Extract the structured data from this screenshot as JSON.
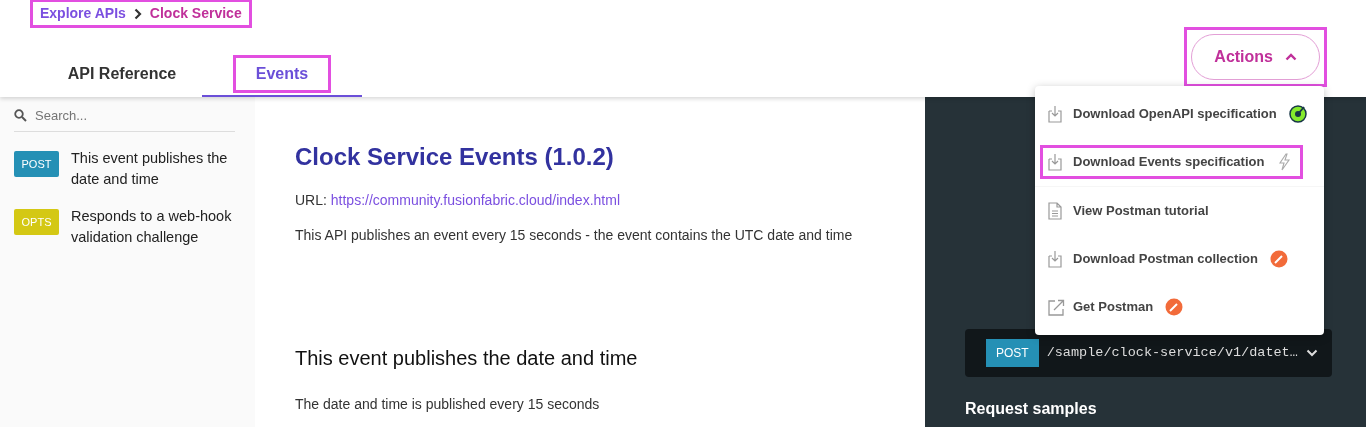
{
  "breadcrumb": {
    "highlighted": true,
    "items": [
      {
        "label": "Explore APIs",
        "current": false
      },
      {
        "label": "Clock Service",
        "current": true
      }
    ]
  },
  "tabs": [
    {
      "label": "API Reference",
      "selected": false,
      "highlighted": false
    },
    {
      "label": "Events",
      "selected": true,
      "highlighted": true
    }
  ],
  "actions_button": {
    "label": "Actions",
    "expanded": true,
    "highlighted": true
  },
  "actions_menu": [
    {
      "label": "Download OpenAPI specification",
      "highlighted": false,
      "divider_after": false
    },
    {
      "label": "Download Events specification",
      "highlighted": true,
      "divider_after": true
    },
    {
      "label": "View Postman tutorial",
      "highlighted": false,
      "divider_after": false
    },
    {
      "label": "Download Postman collection",
      "highlighted": false,
      "divider_after": false
    },
    {
      "label": "Get Postman",
      "highlighted": false,
      "divider_after": false
    }
  ],
  "sidebar": {
    "search": {
      "placeholder": "Search..."
    },
    "items": [
      {
        "method": "POST",
        "color": "#2590b5",
        "label": "This event publishes the date and time"
      },
      {
        "method": "OPTS",
        "color": "#d4c814",
        "label": "Responds to a web-hook validation challenge"
      }
    ]
  },
  "content": {
    "title": "Clock Service Events (1.0.2)",
    "url_label": "URL:",
    "url": "https://community.fusionfabric.cloud/index.html",
    "description": "This API publishes an event every 15 seconds - the event contains the UTC date and time",
    "event_title": "This event publishes the date and time",
    "event_description": "The date and time is published every 15 seconds"
  },
  "right_panel": {
    "endpoint": {
      "method": "POST",
      "path": "/sample/clock-service/v1/datet…"
    },
    "request_samples": "Request samples"
  }
}
